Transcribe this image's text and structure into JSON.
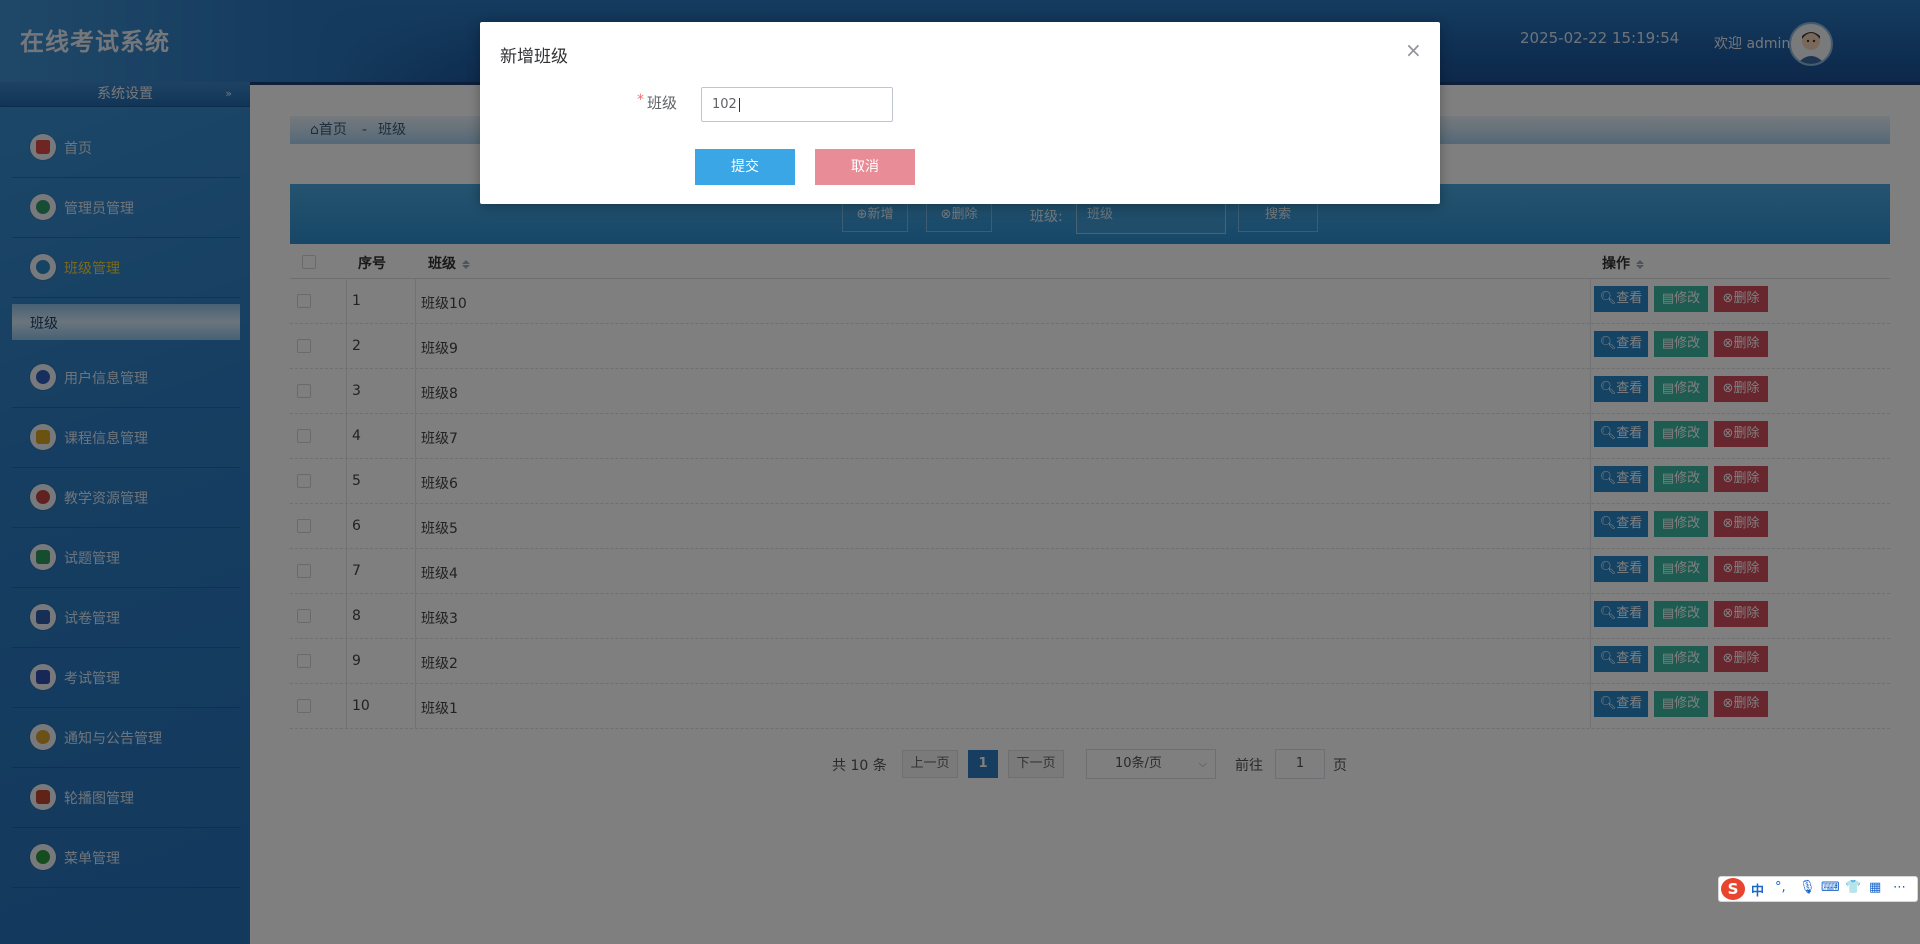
{
  "header": {
    "system_title": "在线考试系统",
    "datetime": "2025-02-22 15:19:54",
    "welcome": "欢迎 admin"
  },
  "sidebar": {
    "section_title": "系统设置",
    "items": [
      {
        "label": "首页",
        "icon": "home-icon",
        "color": "#e04b4b"
      },
      {
        "label": "管理员管理",
        "icon": "admin-icon",
        "color": "#2f9a6a"
      },
      {
        "label": "班级管理",
        "icon": "class-icon",
        "color": "#2a86c9"
      },
      {
        "label": "用户信息管理",
        "icon": "user-icon",
        "color": "#2f5fbf"
      },
      {
        "label": "课程信息管理",
        "icon": "course-icon",
        "color": "#d9a520"
      },
      {
        "label": "教学资源管理",
        "icon": "resource-icon",
        "color": "#c24343"
      },
      {
        "label": "试题管理",
        "icon": "question-icon",
        "color": "#2a9a5c"
      },
      {
        "label": "试卷管理",
        "icon": "paper-icon",
        "color": "#2e5fa8"
      },
      {
        "label": "考试管理",
        "icon": "exam-icon",
        "color": "#2e4fb0"
      },
      {
        "label": "通知与公告管理",
        "icon": "notice-icon",
        "color": "#d7a22a"
      },
      {
        "label": "轮播图管理",
        "icon": "carousel-icon",
        "color": "#c2462e"
      },
      {
        "label": "菜单管理",
        "icon": "menu-icon",
        "color": "#2b9a3f"
      }
    ],
    "active_sub": "班级"
  },
  "breadcrumb": {
    "home": "首页",
    "separator": "-",
    "current": "班级"
  },
  "toolbar": {
    "add_label": "新增",
    "delete_label": "删除",
    "filter_label": "班级:",
    "filter_placeholder": "班级",
    "search_label": "搜索"
  },
  "table": {
    "headers": {
      "index": "序号",
      "class": "班级",
      "actions": "操作"
    },
    "rows": [
      {
        "index": "1",
        "class": "班级10"
      },
      {
        "index": "2",
        "class": "班级9"
      },
      {
        "index": "3",
        "class": "班级8"
      },
      {
        "index": "4",
        "class": "班级7"
      },
      {
        "index": "5",
        "class": "班级6"
      },
      {
        "index": "6",
        "class": "班级5"
      },
      {
        "index": "7",
        "class": "班级4"
      },
      {
        "index": "8",
        "class": "班级3"
      },
      {
        "index": "9",
        "class": "班级2"
      },
      {
        "index": "10",
        "class": "班级1"
      }
    ],
    "row_actions": {
      "view": "查看",
      "edit": "修改",
      "delete": "删除"
    }
  },
  "pagination": {
    "total": "共 10 条",
    "prev": "上一页",
    "current_page": "1",
    "next": "下一页",
    "page_size": "10条/页",
    "goto_label": "前往",
    "goto_value": "1",
    "page_suffix": "页"
  },
  "modal": {
    "title": "新增班级",
    "close": "×",
    "required_mark": "*",
    "field_label": "班级",
    "field_value": "102",
    "submit_label": "提交",
    "cancel_label": "取消"
  },
  "ime_toolbar": {
    "logo": "S",
    "mode": "中"
  },
  "colors": {
    "header_blue": "#1e5fa6",
    "sidebar_blue": "#2c7dc4",
    "toolbar_blue": "#2f8fd0",
    "view_button": "#2a86c9",
    "edit_button": "#3db8a2",
    "delete_button": "#d04d5d",
    "submit_button": "#3aa6e6",
    "cancel_button": "#e88c97",
    "active_menu_text": "#f3d23a"
  }
}
